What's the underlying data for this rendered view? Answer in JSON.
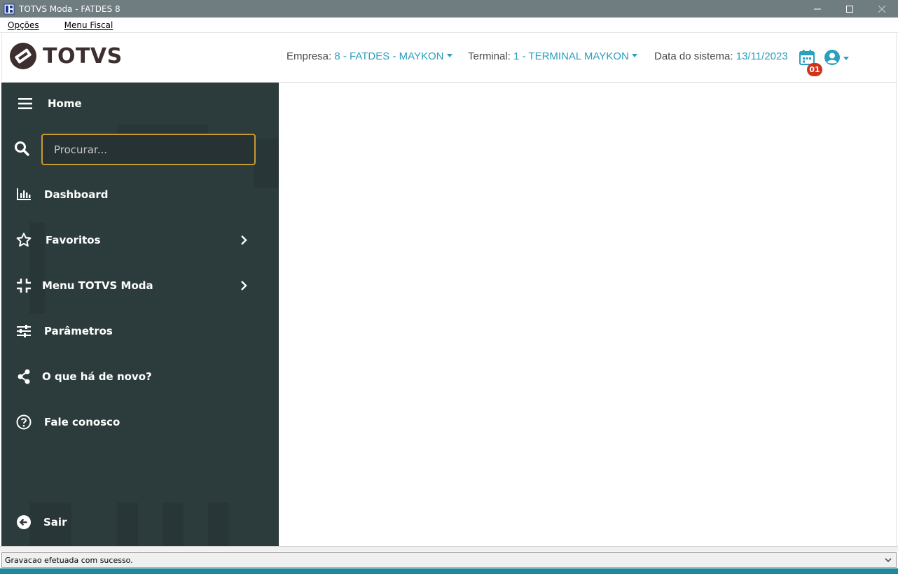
{
  "window": {
    "title": "TOTVS Moda - FATDES 8"
  },
  "menubar": {
    "items": [
      "Opções",
      "Menu Fiscal"
    ]
  },
  "header": {
    "logo_text": "TOTVS",
    "empresa_label": "Empresa:",
    "empresa_value": "8 - FATDES - MAYKON",
    "terminal_label": "Terminal:",
    "terminal_value": "1 - TERMINAL MAYKON",
    "data_label": "Data do sistema:",
    "data_value": "13/11/2023",
    "calendar_badge": "01"
  },
  "sidebar": {
    "home_label": "Home",
    "search_placeholder": "Procurar...",
    "items": [
      {
        "label": "Dashboard",
        "icon": "bar-chart-icon"
      },
      {
        "label": "Favoritos",
        "icon": "star-icon"
      },
      {
        "label": "Menu TOTVS Moda",
        "icon": "compress-icon"
      },
      {
        "label": "Parâmetros",
        "icon": "sliders-icon"
      },
      {
        "label": "O que há de novo?",
        "icon": "share-icon"
      },
      {
        "label": "Fale conosco",
        "icon": "help-icon"
      }
    ],
    "exit_label": "Sair"
  },
  "statusbar": {
    "message": "Gravacao efetuada com sucesso."
  },
  "colors": {
    "accent": "#2a9fbf",
    "sidebar_bg": "#2c3b3c",
    "search_border": "#c79a2e",
    "badge": "#d0321a"
  }
}
